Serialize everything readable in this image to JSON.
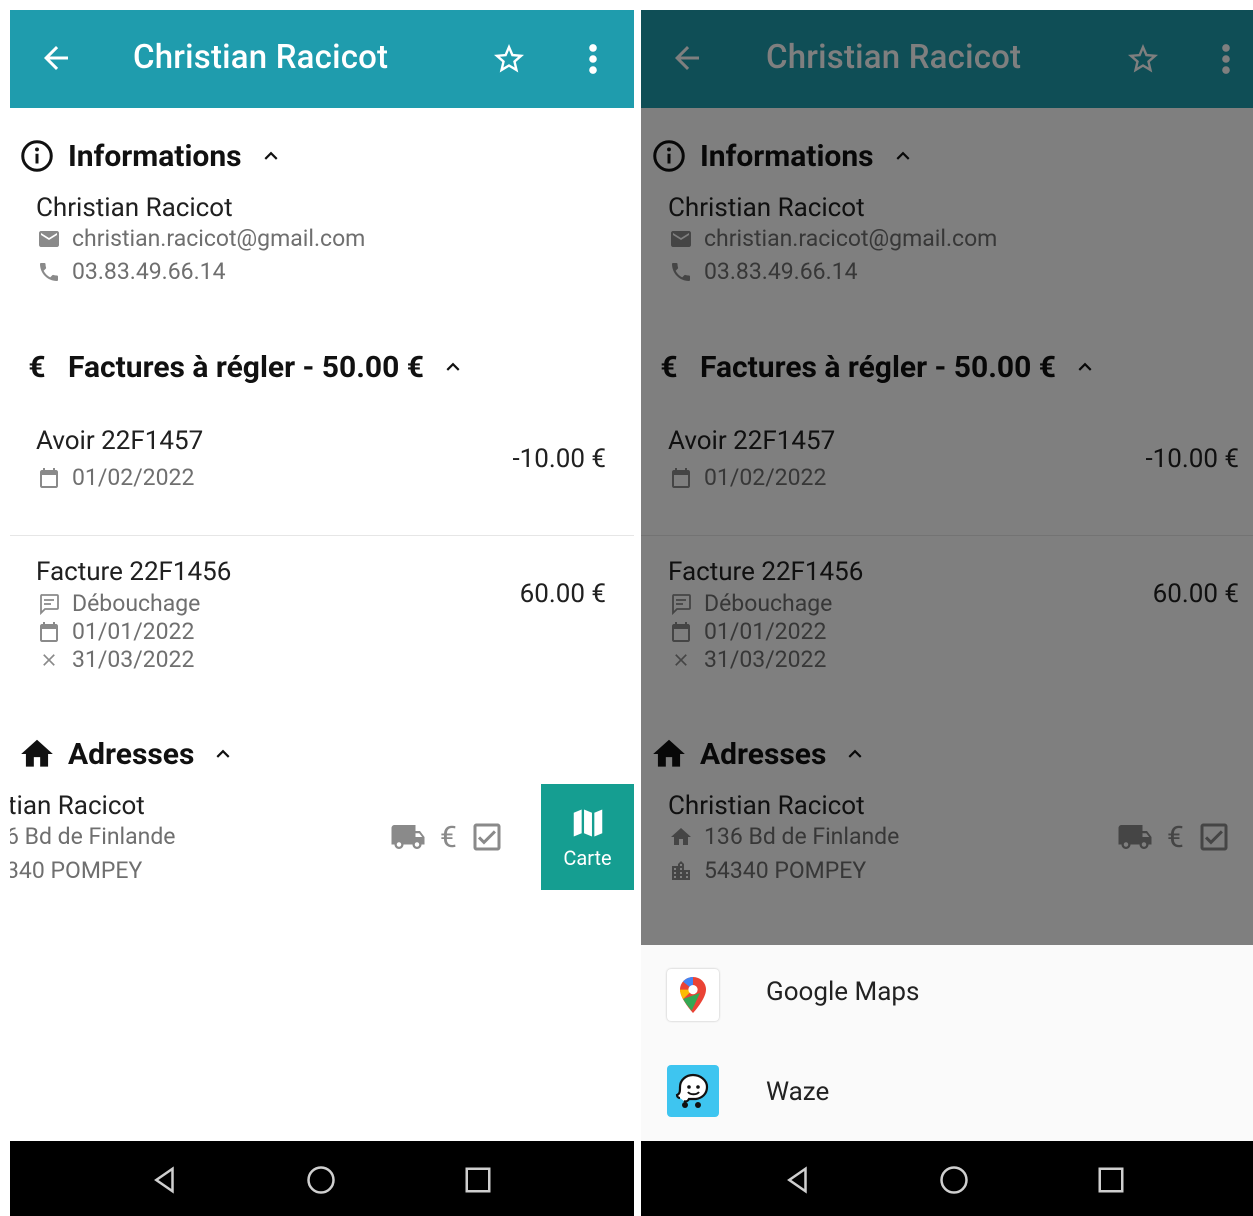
{
  "appbar": {
    "title": "Christian Racicot"
  },
  "informations": {
    "heading": "Informations",
    "name": "Christian Racicot",
    "email": "christian.racicot@gmail.com",
    "phone": "03.83.49.66.14"
  },
  "factures": {
    "heading": "Factures à régler - 50.00 €",
    "items": [
      {
        "title": "Avoir 22F1457",
        "date": "01/02/2022",
        "amount": "-10.00 €"
      },
      {
        "title": "Facture 22F1456",
        "description": "Débouchage",
        "date": "01/01/2022",
        "due": "31/03/2022",
        "amount": "60.00 €"
      }
    ]
  },
  "adresses": {
    "heading": "Adresses",
    "name": "Christian Racicot",
    "street": "136 Bd de Finlande",
    "city": "54340 POMPEY",
    "name_swiped": "tian Racicot",
    "street_swiped": "6 Bd de Finlande",
    "city_swiped": "340 POMPEY",
    "euro": "€"
  },
  "carte": {
    "label": "Carte"
  },
  "chooser": {
    "apps": [
      {
        "name": "Google Maps",
        "icon": "google-maps-icon"
      },
      {
        "name": "Waze",
        "icon": "waze-icon"
      }
    ]
  },
  "colors": {
    "appbar": "#1f9cad",
    "carte": "#159e91",
    "waze": "#3ec5f0"
  }
}
